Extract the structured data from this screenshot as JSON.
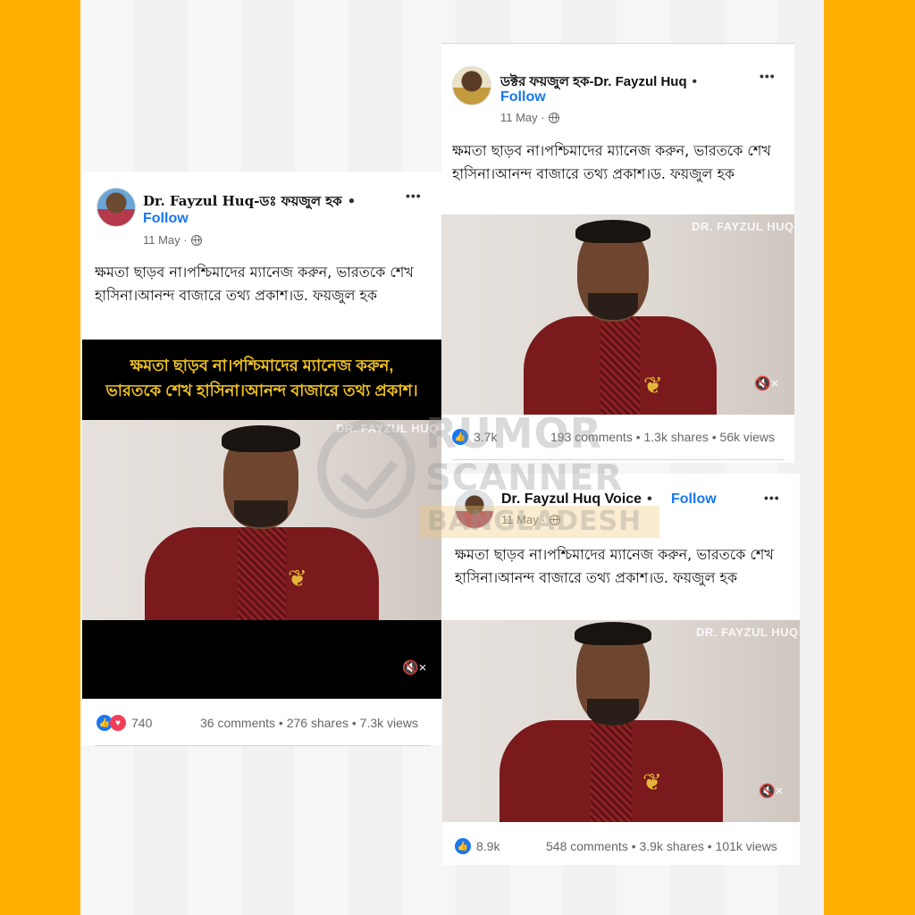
{
  "colors": {
    "frame": "#ffb000",
    "fb_blue": "#1877f2",
    "overlay_yellow": "#f0c21d",
    "shirt": "#7a1a1c"
  },
  "watermark_brand": {
    "line1": "RUMOR",
    "line2": "SCANNER",
    "line3": "BANGLADESH"
  },
  "posts": [
    {
      "author": "Dr. Fayzul Huq-ডঃ ফয়জুল হক",
      "separator": "•",
      "follow": "Follow",
      "date": "11 May ·",
      "more": "•••",
      "caption": "ক্ষমতা ছাড়ব না।পশ্চিমাদের ম্যানেজ করুন, ভারতকে শেখ হাসিনা।আনন্দ বাজারে তথ্য প্রকাশ।ড. ফয়জুল হক",
      "overlay_line1": "ক্ষমতা ছাড়ব না।পশ্চিমাদের ম্যানেজ করুন,",
      "overlay_line2": "ভারতকে শেখ হাসিনা।আনন্দ বাজারে তথ্য প্রকাশ।",
      "video_watermark": "DR. FAYZUL HUQ",
      "mute_icon": "🔇×",
      "reactions": "740",
      "engagement": "36 comments • 276 shares • 7.3k views"
    },
    {
      "author": "ডক্টর ফয়জুল হক-Dr. Fayzul Huq",
      "separator": "•",
      "follow": "Follow",
      "date": "11 May ·",
      "more": "•••",
      "caption": "ক্ষমতা ছাড়ব না।পশ্চিমাদের ম্যানেজ করুন, ভারতকে শেখ হাসিনা।আনন্দ বাজারে তথ্য প্রকাশ।ড. ফয়জুল হক",
      "video_watermark": "DR. FAYZUL HUQ",
      "reactions": "3.7k",
      "engagement": "193 comments • 1.3k shares • 56k views"
    },
    {
      "author": "Dr. Fayzul Huq Voice",
      "separator": "•",
      "follow": "Follow",
      "date": "11 May ·",
      "more": "•••",
      "caption": "ক্ষমতা ছাড়ব না।পশ্চিমাদের ম্যানেজ করুন, ভারতকে শেখ হাসিনা।আনন্দ বাজারে তথ্য প্রকাশ।ড. ফয়জুল হক",
      "video_watermark": "DR. FAYZUL HUQ",
      "reactions": "8.9k",
      "engagement": "548 comments • 3.9k shares • 101k views"
    }
  ]
}
